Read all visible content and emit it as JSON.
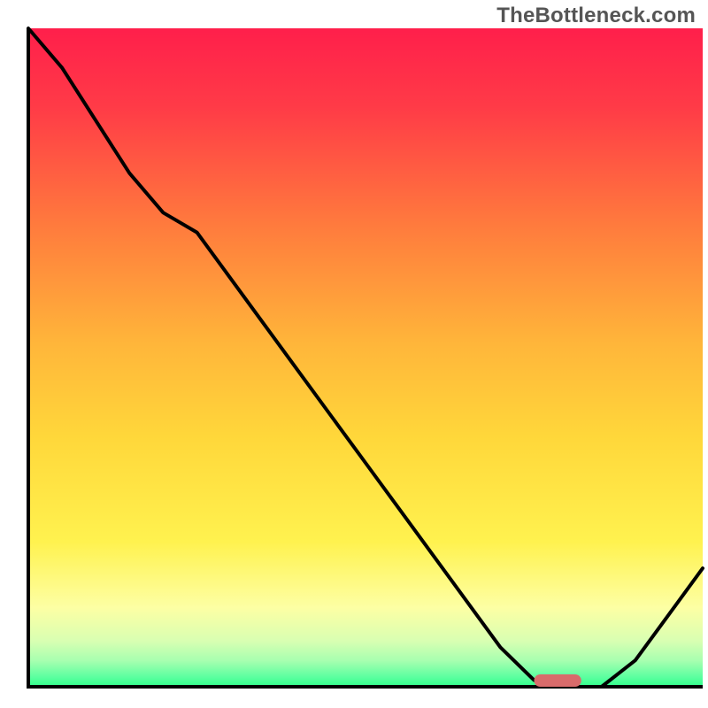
{
  "watermark": "TheBottleneck.com",
  "chart_data": {
    "type": "line",
    "title": "",
    "xlabel": "",
    "ylabel": "",
    "x": [
      0.0,
      0.05,
      0.1,
      0.15,
      0.2,
      0.25,
      0.3,
      0.35,
      0.4,
      0.45,
      0.5,
      0.55,
      0.6,
      0.65,
      0.7,
      0.75,
      0.8,
      0.85,
      0.9,
      0.95,
      1.0
    ],
    "values": [
      1.0,
      0.94,
      0.86,
      0.78,
      0.72,
      0.69,
      0.62,
      0.55,
      0.48,
      0.41,
      0.34,
      0.27,
      0.2,
      0.13,
      0.06,
      0.01,
      0.0,
      0.0,
      0.04,
      0.11,
      0.18
    ],
    "optimum_range_x": [
      0.75,
      0.82
    ],
    "xlim": [
      0,
      1
    ],
    "ylim": [
      0,
      1
    ],
    "legend": [],
    "background_gradient": {
      "top": "#ff1f4b",
      "upper_mid": "#ff9b35",
      "mid": "#ffd73a",
      "lower_mid": "#fff77a",
      "lower": "#cfffb0",
      "bottom": "#2fff8a"
    },
    "curve_color": "#000000",
    "marker_color": "#d86b6b"
  }
}
